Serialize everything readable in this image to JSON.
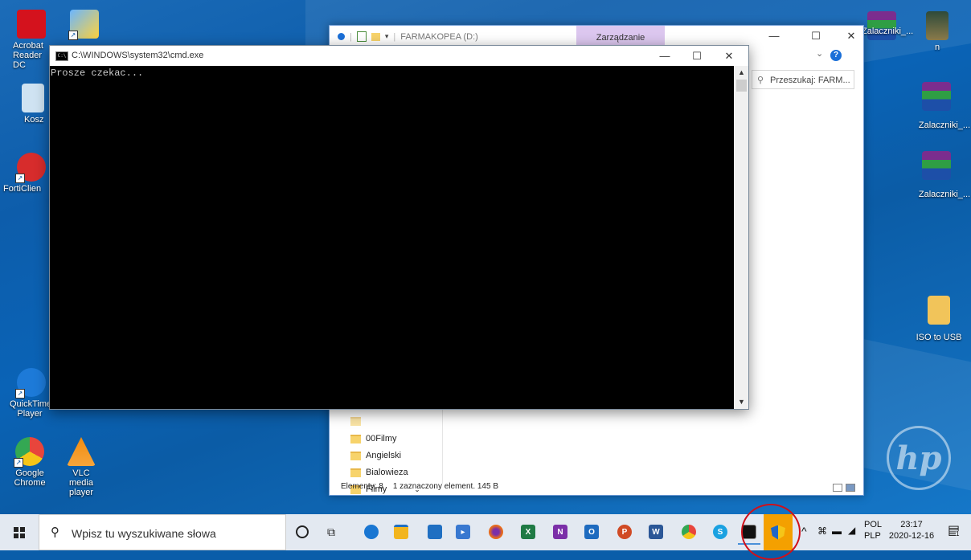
{
  "desktop": {
    "left_icons": [
      {
        "id": "acrobat",
        "label": "Acrobat Reader DC",
        "color": "#d4121d"
      },
      {
        "id": "wizard",
        "label": "",
        "color": "#3a8ed8"
      },
      {
        "id": "recycle",
        "label": "Kosz",
        "color": "#cfe3f2"
      },
      {
        "id": "forticlient",
        "label": "FortiClien",
        "color": "#d72c2c"
      },
      {
        "id": "quicktime",
        "label": "QuickTime Player",
        "color": "#1d7ad8"
      },
      {
        "id": "chrome",
        "label": "Google Chrome",
        "color": "#e8453c"
      },
      {
        "id": "vlc",
        "label": "VLC media player",
        "color": "#f28c0f"
      }
    ],
    "right_icons": [
      {
        "id": "zal1",
        "label": "Zalaczniki_...",
        "color": "#7b2d8e"
      },
      {
        "id": "n",
        "label": "n",
        "color": "#7b6a3a"
      },
      {
        "id": "zal2",
        "label": "Zalaczniki_...",
        "color": "#7b2d8e"
      },
      {
        "id": "zal3",
        "label": "Zalaczniki_...",
        "color": "#7b2d8e"
      },
      {
        "id": "iso",
        "label": "ISO to USB",
        "color": "#f1c45a"
      }
    ]
  },
  "explorer": {
    "title": "FARMAKOPEA (D:)",
    "manage_tab": "Zarządzanie",
    "search_placeholder": "Przeszukaj: FARM...",
    "nav_items": [
      "00Filmy",
      "Angielski",
      "Bialowieza",
      "Filmy"
    ],
    "status_count": "Elementy: 8",
    "status_selected": "1 zaznaczony element. 145 B"
  },
  "cmd": {
    "title": "C:\\WINDOWS\\system32\\cmd.exe",
    "output": "Prosze czekac..."
  },
  "taskbar": {
    "search_placeholder": "Wpisz tu wyszukiwane słowa",
    "lang1": "POL",
    "lang2": "PLP",
    "time": "23:17",
    "date": "2020-12-16",
    "notifications": "1",
    "apps": [
      {
        "id": "cortana",
        "color": "#222222"
      },
      {
        "id": "taskview",
        "color": "#222222"
      },
      {
        "id": "edge",
        "color": "#1976d2"
      },
      {
        "id": "file-explorer",
        "color": "#f2b51e"
      },
      {
        "id": "store",
        "color": "#1f6fc2"
      },
      {
        "id": "media",
        "color": "#3878d0"
      },
      {
        "id": "firefox",
        "color": "#e76b1c"
      },
      {
        "id": "excel",
        "color": "#1f7a44"
      },
      {
        "id": "onenote",
        "color": "#7b2fa8"
      },
      {
        "id": "outlook",
        "color": "#1e6bbf"
      },
      {
        "id": "powerpoint",
        "color": "#d04a24"
      },
      {
        "id": "word",
        "color": "#2b5797"
      },
      {
        "id": "chrome",
        "color": "#e8453c"
      },
      {
        "id": "skype",
        "color": "#1aa1e1"
      },
      {
        "id": "cmd",
        "color": "#111111"
      },
      {
        "id": "uac-shield",
        "color": "#1f66c9"
      }
    ]
  }
}
